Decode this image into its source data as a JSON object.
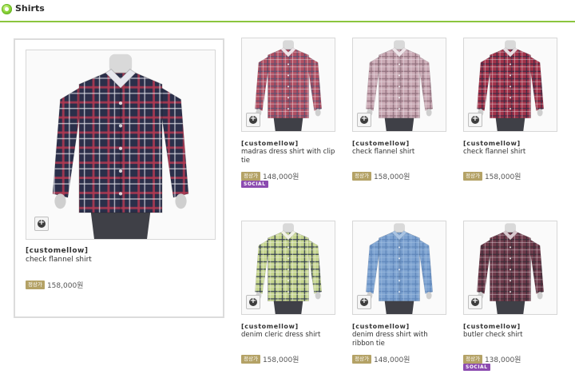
{
  "header": {
    "title": "Shirts"
  },
  "colors": {
    "accent": "#8bc63e",
    "badge": "#b4a266",
    "social": "#8c4bb0"
  },
  "featured": {
    "brand": "[customellow]",
    "name": "check flannel shirt",
    "badge": "정상가",
    "price": "158,000원",
    "shirt_colors": [
      "#2b2f4a",
      "#b23a52",
      "#e7e7ee"
    ]
  },
  "products": [
    {
      "brand": "[customellow]",
      "name": "madras dress shirt with clip tie",
      "badge": "정상가",
      "price": "148,000원",
      "social": "SOCIAL",
      "shirt_colors": [
        "#b14f62",
        "#5a5070",
        "#f0e6ea"
      ]
    },
    {
      "brand": "[customellow]",
      "name": "check flannel shirt",
      "badge": "정상가",
      "price": "158,000원",
      "social": "",
      "shirt_colors": [
        "#c9a8b3",
        "#8d6d7a",
        "#efe6ea"
      ]
    },
    {
      "brand": "[customellow]",
      "name": "check flannel shirt",
      "badge": "정상가",
      "price": "158,000원",
      "social": "",
      "shirt_colors": [
        "#a23249",
        "#3c2a44",
        "#e8dde2"
      ]
    },
    {
      "brand": "[customellow]",
      "name": "denim cleric dress shirt",
      "badge": "정상가",
      "price": "158,000원",
      "social": "",
      "shirt_colors": [
        "#c5d58e",
        "#2f3a4e",
        "#f1f2e6"
      ]
    },
    {
      "brand": "[customellow]",
      "name": "denim dress shirt with ribbon tie",
      "badge": "정상가",
      "price": "148,000원",
      "social": "",
      "shirt_colors": [
        "#7ea3d1",
        "#5d85b9",
        "#a9c4e3"
      ]
    },
    {
      "brand": "[customellow]",
      "name": "butler check shirt",
      "badge": "정상가",
      "price": "138,000원",
      "social": "SOCIAL",
      "shirt_colors": [
        "#6e3a4a",
        "#3a2a36",
        "#d9c9cf"
      ]
    }
  ]
}
